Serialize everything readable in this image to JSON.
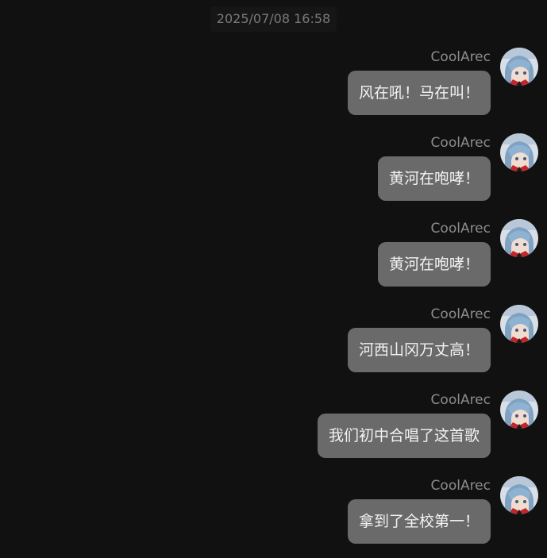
{
  "chat": {
    "timestamp": "2025/07/08 16:58",
    "messages": [
      {
        "sender": "CoolArec",
        "text": "风在吼！马在叫！"
      },
      {
        "sender": "CoolArec",
        "text": "黄河在咆哮！"
      },
      {
        "sender": "CoolArec",
        "text": "黄河在咆哮！"
      },
      {
        "sender": "CoolArec",
        "text": "河西山冈万丈高！"
      },
      {
        "sender": "CoolArec",
        "text": "我们初中合唱了这首歌"
      },
      {
        "sender": "CoolArec",
        "text": "拿到了全校第一！"
      }
    ]
  },
  "colors": {
    "background": "#111111",
    "bubble": "#6a6a6a",
    "sender_text": "#8c8c8c",
    "timestamp_text": "#7a7a7a"
  },
  "icons": {
    "avatar": "anime-character-avatar"
  }
}
